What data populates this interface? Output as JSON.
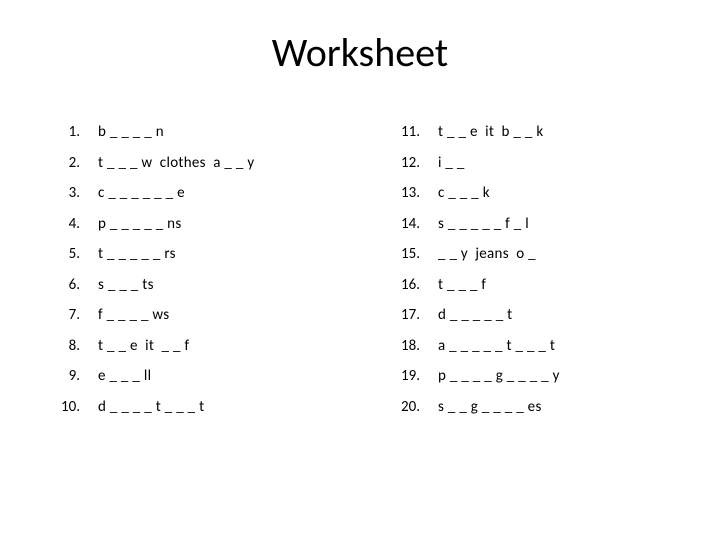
{
  "title": "Worksheet",
  "left": {
    "nums": [
      "1.",
      "2.",
      "3.",
      "4.",
      "5.",
      "6.",
      "7.",
      "8.",
      "9.",
      "10."
    ],
    "items": [
      "b _ _ _ _ n",
      "t _ _ _ w  clothes  a _ _ y",
      "c _ _ _ _ _ _ e",
      "p _ _ _ _ _ ns",
      "t _ _ _ _ _ rs",
      "s _ _ _ ts",
      "f _ _ _ _ ws",
      "t _ _ e  it  _ _ f",
      "e _ _ _ ll",
      "d _ _ _ _ t _ _ _ t"
    ]
  },
  "right": {
    "nums": [
      "11.",
      "12.",
      "13.",
      "14.",
      "15.",
      "16.",
      "17.",
      "18.",
      "19.",
      "20."
    ],
    "items": [
      "t _ _ e  it  b _ _ k",
      "i _ _",
      "c _ _ _ k",
      "s _ _ _ _ _ f _ l",
      "_ _ y  jeans  o _",
      "t _ _ _ f",
      "d _ _ _ _ _ t",
      "a _ _ _ _ _ t _ _ _ t",
      "p _ _ _ _ g _ _ _ _ y",
      "s _ _ g _ _ _ _ es"
    ]
  }
}
